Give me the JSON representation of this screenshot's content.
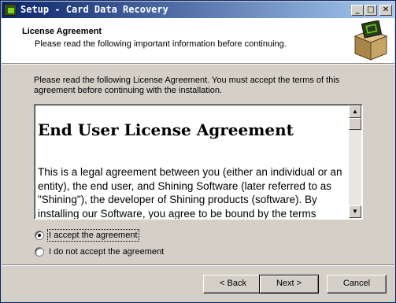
{
  "window": {
    "title": "Setup - Card Data Recovery",
    "minimize_glyph": "_",
    "maximize_glyph": "□",
    "close_glyph": "✕"
  },
  "header": {
    "title": "License Agreement",
    "subtitle": "Please read the following important information before continuing."
  },
  "intro_text": "Please read the following License Agreement. You must accept the terms of this agreement before continuing with the installation.",
  "license": {
    "heading": "End User License Agreement",
    "body": "This is a legal agreement between you (either an individual or an entity), the end user, and Shining  Software (later referred to as \"Shining\"), the developer of Shining  products (software). By installing our Software, you agree to be bound by the terms"
  },
  "scrollbar": {
    "up_glyph": "▲",
    "down_glyph": "▼"
  },
  "options": {
    "accept": "I accept the agreement",
    "decline": "I do not accept the agreement",
    "selected": "accept"
  },
  "buttons": {
    "back": "< Back",
    "next": "Next >",
    "cancel": "Cancel"
  }
}
